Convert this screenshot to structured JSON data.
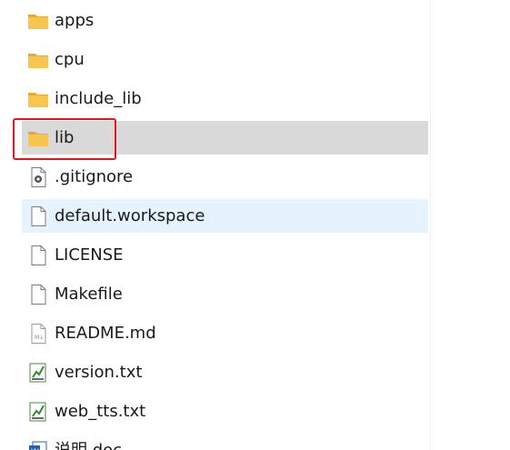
{
  "file_list": {
    "items": [
      {
        "name": "apps",
        "type": "folder",
        "icon": "folder-icon",
        "state": "normal"
      },
      {
        "name": "cpu",
        "type": "folder",
        "icon": "folder-icon",
        "state": "normal"
      },
      {
        "name": "include_lib",
        "type": "folder",
        "icon": "folder-icon",
        "state": "normal"
      },
      {
        "name": "lib",
        "type": "folder",
        "icon": "folder-icon",
        "state": "selected"
      },
      {
        "name": ".gitignore",
        "type": "file",
        "icon": "config-file-icon",
        "state": "normal"
      },
      {
        "name": "default.workspace",
        "type": "file",
        "icon": "blank-file-icon",
        "state": "hovered"
      },
      {
        "name": "LICENSE",
        "type": "file",
        "icon": "blank-file-icon",
        "state": "normal"
      },
      {
        "name": "Makefile",
        "type": "file",
        "icon": "blank-file-icon",
        "state": "normal"
      },
      {
        "name": "README.md",
        "type": "file",
        "icon": "markdown-file-icon",
        "state": "normal"
      },
      {
        "name": "version.txt",
        "type": "file",
        "icon": "text-file-icon",
        "state": "normal"
      },
      {
        "name": "web_tts.txt",
        "type": "file",
        "icon": "text-file-icon",
        "state": "normal"
      },
      {
        "name": "说明.doc",
        "type": "file",
        "icon": "word-doc-icon",
        "state": "normal"
      }
    ]
  },
  "colors": {
    "selected_row": "#d9d9d9",
    "hovered_row": "#e5f3ff",
    "highlight_box": "#e8141c",
    "folder": "#f8c54e"
  }
}
